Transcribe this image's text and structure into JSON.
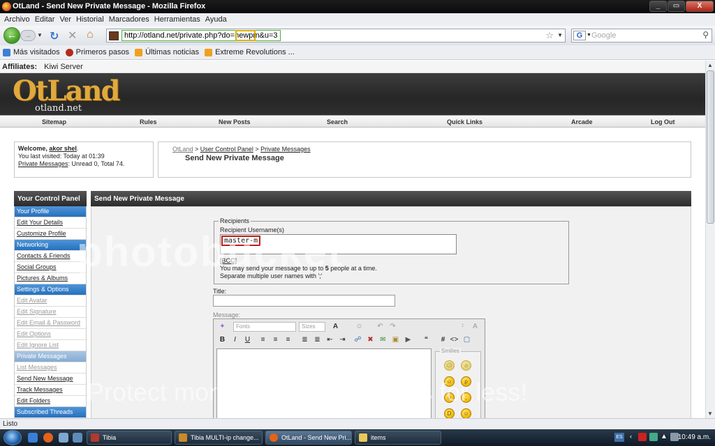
{
  "window": {
    "title": "OtLand - Send New Private Message - Mozilla Firefox",
    "buttons": [
      "_",
      "▭",
      "X"
    ]
  },
  "menu": [
    "Archivo",
    "Editar",
    "Ver",
    "Historial",
    "Marcadores",
    "Herramientas",
    "Ayuda"
  ],
  "nav": {
    "url": "http://otland.net/private.php?do=newpm&u=3",
    "search_placeholder": "Google",
    "google_letter": "G"
  },
  "bookmarks": [
    {
      "label": "Más visitados",
      "color": "#3f7fd6"
    },
    {
      "label": "Primeros pasos",
      "color": "#b42a1d"
    },
    {
      "label": "Últimas noticias",
      "color": "#f0a020"
    },
    {
      "label": "Extreme Revolutions ...",
      "color": "#f0a020"
    }
  ],
  "affiliates": {
    "label": "Affiliates:",
    "value": "Kiwi Server"
  },
  "logo": {
    "main": "OtLand",
    "sub": "otland.net"
  },
  "site_nav": [
    "Sitemap",
    "Rules",
    "New Posts",
    "Search",
    "Quick Links",
    "Arcade",
    "Log Out"
  ],
  "welcome": {
    "greeting": "Welcome,",
    "user": "akor shel",
    "last_visit": "You last visited: Today at 01:39",
    "pm_link": "Private Messages",
    "pm_stats": ": Unread 0, Total 74."
  },
  "breadcrumb": {
    "root": "OtLand",
    "items": [
      "User Control Panel",
      "Private Messages"
    ],
    "current": "Send New Private Message",
    "current_muted": "Send"
  },
  "control_panel": {
    "title": "Your Control Panel",
    "items": [
      {
        "label": "Your Profile",
        "style": "head"
      },
      {
        "label": "Edit Your Details",
        "style": "link"
      },
      {
        "label": "Customize Profile",
        "style": "link"
      },
      {
        "label": "Networking",
        "style": "head"
      },
      {
        "label": "Contacts & Friends",
        "style": "link"
      },
      {
        "label": "Social Groups",
        "style": "link"
      },
      {
        "label": "Pictures & Albums",
        "style": "link"
      },
      {
        "label": "Settings & Options",
        "style": "head"
      },
      {
        "label": "Edit Avatar",
        "style": "grey"
      },
      {
        "label": "Edit Signature",
        "style": "grey"
      },
      {
        "label": "Edit Email & Password",
        "style": "grey"
      },
      {
        "label": "Edit Options",
        "style": "grey"
      },
      {
        "label": "Edit Ignore List",
        "style": "grey"
      },
      {
        "label": "Private Messages",
        "style": "headgrey"
      },
      {
        "label": "List Messages",
        "style": "grey"
      },
      {
        "label": "Send New Message",
        "style": "link"
      },
      {
        "label": "Track Messages",
        "style": "link"
      },
      {
        "label": "Edit Folders",
        "style": "link"
      },
      {
        "label": "Subscribed Threads",
        "style": "head"
      }
    ]
  },
  "main": {
    "title": "Send New Private Message",
    "recipients": {
      "legend": "Recipients",
      "label": "Recipient Username(s)",
      "value": "master-m",
      "bcc": "[BCC]",
      "note1_pre": "You may send your message to up to ",
      "note1_num": "5",
      "note1_post": " people at a time.",
      "note2": "Separate multiple user names with ';'"
    },
    "title_label": "Title:",
    "message_label": "Message:",
    "editor": {
      "font_select": "Fonts",
      "size_select": "Sizes",
      "smilies_label": "Smilies"
    }
  },
  "watermark": {
    "line1": "photobucket",
    "line2": "Protect more of your memories for less!"
  },
  "status": "Listo",
  "taskbar": {
    "tasks": [
      {
        "label": "Tibia",
        "color": "#b03a2e",
        "active": false
      },
      {
        "label": "Tibia MULTI-ip change...",
        "color": "#c88a2a",
        "active": false
      },
      {
        "label": "OtLand - Send New Pri...",
        "color": "#e2631c",
        "active": true
      },
      {
        "label": "items",
        "color": "#e8c85a",
        "active": false
      }
    ],
    "lang": "ES",
    "clock": "10:49 a.m."
  }
}
